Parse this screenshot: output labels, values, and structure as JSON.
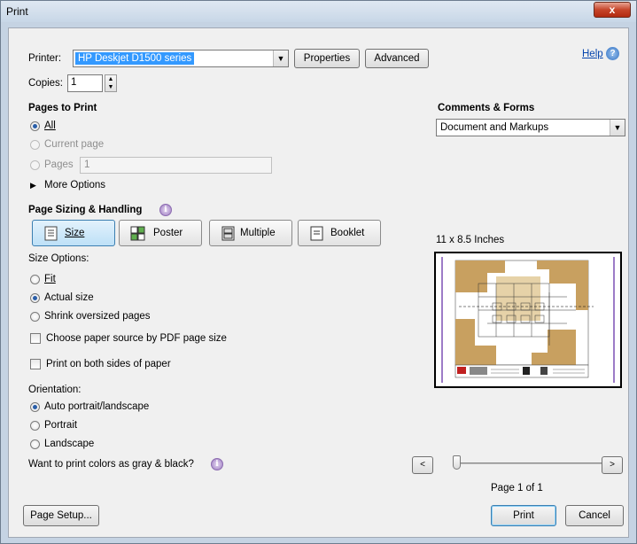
{
  "window": {
    "title": "Print",
    "close_glyph": "x"
  },
  "printer": {
    "label": "Printer:",
    "selected": "HP Deskjet D1500 series",
    "properties_label": "Properties",
    "advanced_label": "Advanced",
    "help_label": "Help"
  },
  "copies": {
    "label": "Copies:",
    "value": "1"
  },
  "pages_to_print": {
    "heading": "Pages to Print",
    "all_label": "All",
    "current_label": "Current page",
    "pages_label": "Pages",
    "pages_value": "1",
    "more_options_label": "More Options"
  },
  "comments_forms": {
    "heading": "Comments & Forms",
    "selected": "Document and Markups"
  },
  "sizing": {
    "heading": "Page Sizing & Handling",
    "tabs": [
      {
        "label": "Size",
        "selected": true
      },
      {
        "label": "Poster",
        "selected": false
      },
      {
        "label": "Multiple",
        "selected": false
      },
      {
        "label": "Booklet",
        "selected": false
      }
    ],
    "size_options_label": "Size Options:",
    "fit_label": "Fit",
    "actual_label": "Actual size",
    "shrink_label": "Shrink oversized pages",
    "paper_source_label": "Choose paper source by PDF page size",
    "both_sides_label": "Print on both sides of paper"
  },
  "orientation": {
    "label": "Orientation:",
    "auto_label": "Auto portrait/landscape",
    "portrait_label": "Portrait",
    "landscape_label": "Landscape"
  },
  "gray_label": "Want to print colors as gray & black?",
  "preview": {
    "size_label": "11 x 8.5 Inches",
    "page_label": "Page 1 of 1",
    "prev_glyph": "<",
    "next_glyph": ">"
  },
  "footer": {
    "page_setup_label": "Page Setup...",
    "print_label": "Print",
    "cancel_label": "Cancel"
  },
  "colors": {
    "selection": "#3399ff",
    "plan_tan": "#c8a060",
    "preview_border": "#9d7cc7"
  }
}
